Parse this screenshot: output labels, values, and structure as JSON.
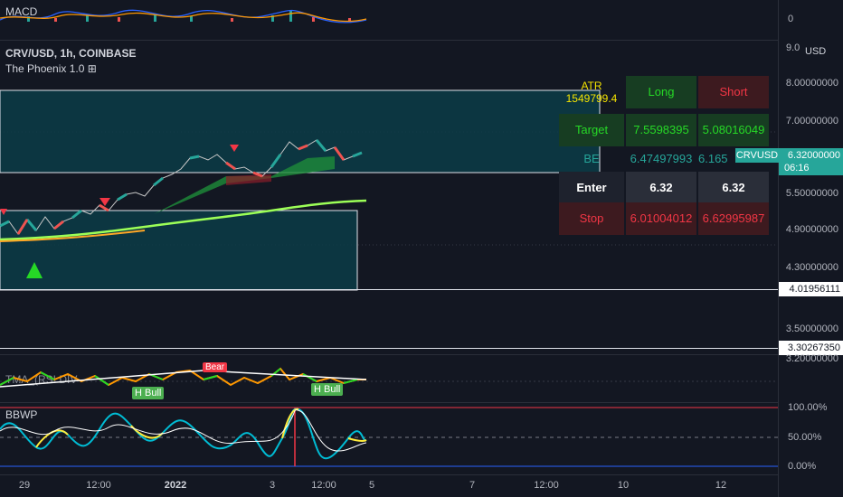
{
  "chart_header": {
    "symbol": "CRV/USD, 1h, COINBASE",
    "indicator": "The Phoenix 1.0 ⊞",
    "macd_label": "MACD",
    "tma_label": "TMA_(RSI DIV",
    "bbwp_label": "BBWP"
  },
  "price_axis": {
    "currency": "USD",
    "macd_zero": "0",
    "ticks": [
      "9.0",
      "8.00000000",
      "7.00000000",
      "5.50000000",
      "4.90000000",
      "4.30000000",
      "3.50000000",
      "3.20000000"
    ],
    "current_price": "6.32000000",
    "current_symbol": "CRVUSD",
    "countdown": "06:16",
    "level_a": "4.01956111",
    "level_b": "3.30267350",
    "bbwp_ticks": [
      "100.00%",
      "50.00%",
      "0.00%"
    ]
  },
  "time_axis": [
    "29",
    "12:00",
    "2022",
    "3",
    "12:00",
    "5",
    "7",
    "12:00",
    "10",
    "12"
  ],
  "signals": {
    "bear": "Bear",
    "hbull_1": "H Bull",
    "hbull_2": "H Bull"
  },
  "trade_table": {
    "atr_label": "ATR",
    "atr_value": "1549799.4",
    "long_label": "Long",
    "short_label": "Short",
    "target_label": "Target",
    "target_long": "7.5598395",
    "target_short": "5.08016049",
    "be_label": "BE",
    "be_long": "6.47497993",
    "be_short": "6.165",
    "enter_label": "Enter",
    "enter_long": "6.32",
    "enter_short": "6.32",
    "stop_label": "Stop",
    "stop_long": "6.01004012",
    "stop_short": "6.62995987"
  },
  "colors": {
    "background": "#131722",
    "long_green": "#26d926",
    "short_red": "#f23645",
    "atr_yellow": "#f5e400",
    "teal": "#26a69a",
    "box_fill": "#0c3c46"
  }
}
